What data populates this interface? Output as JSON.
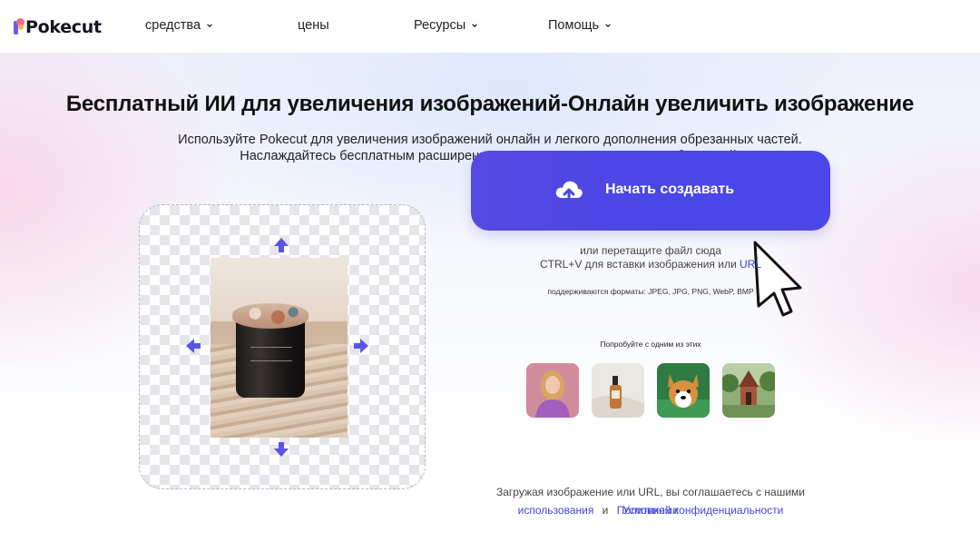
{
  "brand": {
    "logo_text": "Pokecut"
  },
  "nav": {
    "tools": "средства",
    "pricing": "цены",
    "resources": "Ресурсы",
    "help": "Помощь"
  },
  "hero": {
    "title": "Бесплатный ИИ для увеличения изображений-Онлайн увеличить изображение",
    "subtitle_line1": "Используйте Pokecut для увеличения изображений онлайн и легкого дополнения обрезанных частей.",
    "subtitle_line2": "Наслаждайтесь бесплатным расширением качественного контента изображений."
  },
  "upload": {
    "button_label": "Начать создавать",
    "drag_text": "или перетащите файл сюда",
    "paste_text": "CTRL+V для вставки изображения или",
    "url_link": "URL",
    "formats_text": "поддерживаются форматы: JPEG, JPG, PNG, WebP, BMP"
  },
  "samples": {
    "label": "Попробуйте с одним из этих",
    "items": [
      "woman-portrait",
      "cosmetic-bottle",
      "corgi-dog",
      "chapel"
    ]
  },
  "terms": {
    "prefix": "Загружая изображение или URL, вы соглашаетесь с нашими",
    "terms_link_part1": "Условиями",
    "terms_link_part2": "использования",
    "conjunction": "и",
    "privacy_link": "Политикой конфиденциальности"
  },
  "colors": {
    "accent": "#4b46e6",
    "link": "#3f45dd",
    "arrow": "#5a55e8"
  }
}
